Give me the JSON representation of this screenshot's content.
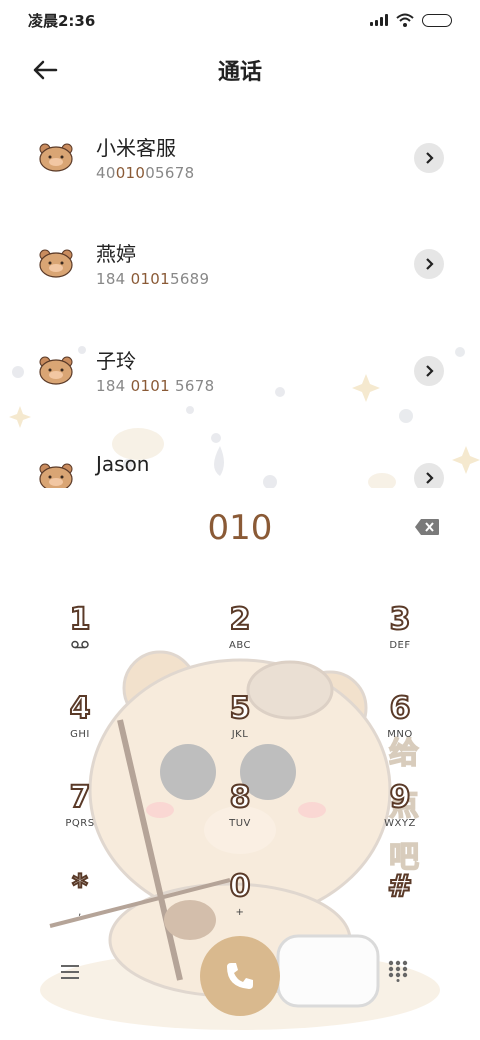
{
  "status": {
    "time": "凌晨2:36"
  },
  "header": {
    "title": "通话"
  },
  "contacts": [
    {
      "name": "小米客服",
      "number_parts": [
        "400",
        "1005678"
      ],
      "pre": "40",
      "hl": "010",
      "post": "05678"
    },
    {
      "name": "燕婷",
      "pre": "184 ",
      "hl": "0101",
      "post": "5689"
    },
    {
      "name": "子玲",
      "pre": "184 ",
      "hl": "0101",
      "post": " 5678"
    },
    {
      "name": "Jason",
      "pre": "",
      "hl": "",
      "post": ""
    }
  ],
  "dialer": {
    "digits": "010"
  },
  "keys": [
    {
      "digit": "1",
      "sub": "oo"
    },
    {
      "digit": "2",
      "sub": "ABC"
    },
    {
      "digit": "3",
      "sub": "DEF"
    },
    {
      "digit": "4",
      "sub": "GHI"
    },
    {
      "digit": "5",
      "sub": "JKL"
    },
    {
      "digit": "6",
      "sub": "MNO"
    },
    {
      "digit": "7",
      "sub": "PQRS"
    },
    {
      "digit": "8",
      "sub": "TUV"
    },
    {
      "digit": "9",
      "sub": "WXYZ"
    },
    {
      "digit": "*",
      "sub": ","
    },
    {
      "digit": "0",
      "sub": "+"
    },
    {
      "digit": "#",
      "sub": ""
    }
  ],
  "wallpaper_text": [
    "给",
    "点",
    "吧"
  ],
  "colors": {
    "accent": "#8a5a36",
    "call": "#d9b98e"
  }
}
